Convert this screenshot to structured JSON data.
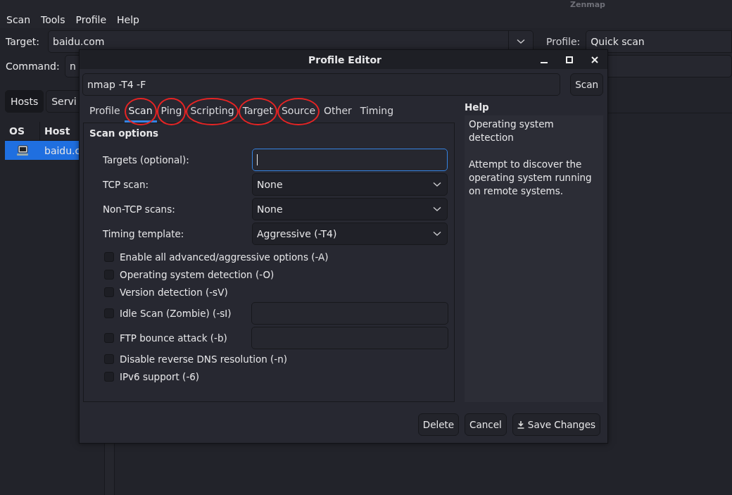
{
  "window": {
    "title": "Zenmap"
  },
  "menu": [
    "Scan",
    "Tools",
    "Profile",
    "Help"
  ],
  "toolbar": {
    "target_label": "Target:",
    "target_value": "baidu.com",
    "profile_label": "Profile:",
    "profile_value": "Quick scan",
    "command_label": "Command:",
    "command_value": "n"
  },
  "view_tabs": [
    {
      "label": "Hosts",
      "selected": true
    },
    {
      "label": "Servi",
      "selected": false
    }
  ],
  "hosts_table": {
    "columns": [
      "OS",
      "Host"
    ],
    "rows": [
      {
        "host": "baidu.c",
        "selected": true
      }
    ]
  },
  "dialog": {
    "title": "Profile Editor",
    "command": "nmap -T4 -F",
    "scan_button": "Scan",
    "tabs": [
      {
        "label": "Profile",
        "selected": false,
        "circled": false
      },
      {
        "label": "Scan",
        "selected": true,
        "circled": true
      },
      {
        "label": "Ping",
        "selected": false,
        "circled": true
      },
      {
        "label": "Scripting",
        "selected": false,
        "circled": true
      },
      {
        "label": "Target",
        "selected": false,
        "circled": true
      },
      {
        "label": "Source",
        "selected": false,
        "circled": true
      },
      {
        "label": "Other",
        "selected": false,
        "circled": false
      },
      {
        "label": "Timing",
        "selected": false,
        "circled": false
      }
    ],
    "section_title": "Scan options",
    "fields": [
      {
        "kind": "input",
        "label": "Targets (optional):",
        "focused": true
      },
      {
        "kind": "select",
        "label": "TCP scan:",
        "value": "None"
      },
      {
        "kind": "select",
        "label": "Non-TCP scans:",
        "value": "None"
      },
      {
        "kind": "select",
        "label": "Timing template:",
        "value": "Aggressive (-T4)"
      }
    ],
    "options": [
      {
        "label": "Enable all advanced/aggressive options (-A)",
        "checked": false,
        "has_field": false
      },
      {
        "label": "Operating system detection (-O)",
        "checked": false,
        "has_field": false
      },
      {
        "label": "Version detection (-sV)",
        "checked": false,
        "has_field": false
      },
      {
        "label": "Idle Scan (Zombie) (-sI)",
        "checked": false,
        "has_field": true
      },
      {
        "label": "FTP bounce attack (-b)",
        "checked": false,
        "has_field": true
      },
      {
        "label": "Disable reverse DNS resolution (-n)",
        "checked": false,
        "has_field": false
      },
      {
        "label": "IPv6 support (-6)",
        "checked": false,
        "has_field": false
      }
    ],
    "help": {
      "title": "Help",
      "heading": "Operating system detection",
      "body": "Attempt to discover the operating system running on remote systems."
    },
    "buttons": [
      {
        "label": "Delete",
        "kind": "plain"
      },
      {
        "label": "Cancel",
        "kind": "plain"
      },
      {
        "label": "Save Changes",
        "kind": "save"
      }
    ]
  }
}
